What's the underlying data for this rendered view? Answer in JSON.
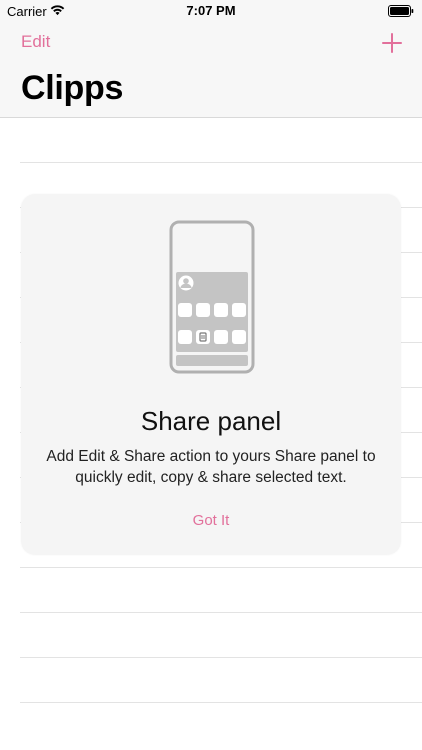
{
  "status_bar": {
    "carrier": "Carrier",
    "time": "7:07 PM"
  },
  "nav": {
    "edit_label": "Edit",
    "title": "Clipps",
    "add_icon": "plus-icon"
  },
  "share_panel": {
    "title": "Share panel",
    "body": "Add Edit & Share action to yours Share panel to quickly edit, copy & share selected text.",
    "button_label": "Got It",
    "illustration_icon": "phone-share-sheet-icon"
  },
  "colors": {
    "accent": "#e2709b",
    "nav_background": "#f7f7f7",
    "card_background": "#f5f5f5",
    "separator": "#e3e3e3",
    "illustration_gray": "#b0b0b0"
  }
}
